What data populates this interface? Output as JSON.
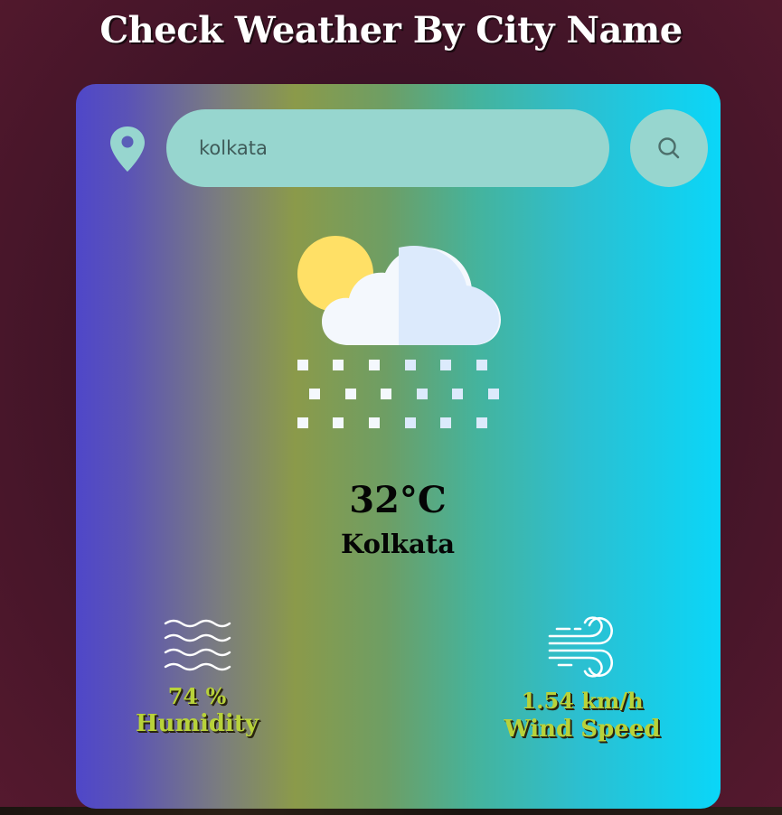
{
  "page": {
    "title": "Check Weather By City Name"
  },
  "search": {
    "value": "kolkata",
    "location_icon": "map-pin-icon",
    "button_icon": "search-icon"
  },
  "weather": {
    "condition_icon": "partly-cloudy-snow-icon",
    "temperature": "32°C",
    "city": "Kolkata"
  },
  "humidity": {
    "icon": "humidity-waves-icon",
    "value": "74 %",
    "label": "Humidity"
  },
  "wind": {
    "icon": "wind-icon",
    "value": "1.54 km/h",
    "label": "Wind Speed"
  },
  "colors": {
    "card_gradient_start": "#4f47c9",
    "card_gradient_mid": "#8b9a4a",
    "card_gradient_end": "#0ad6f8",
    "input_background": "#97d6cf",
    "stat_text": "#b8d23a",
    "page_background": "#3c1326"
  }
}
